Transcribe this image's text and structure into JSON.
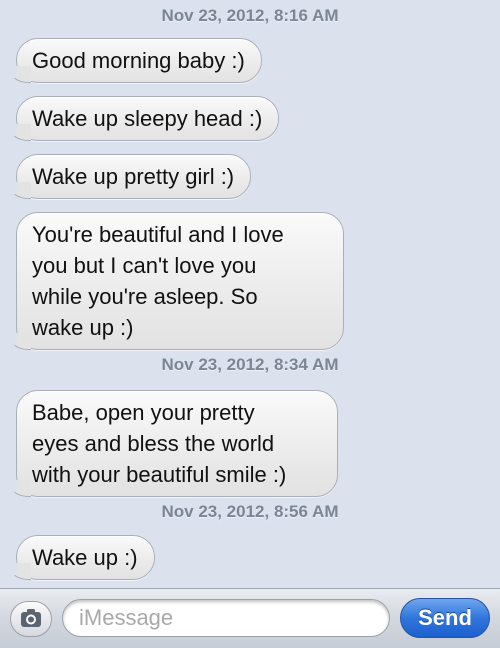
{
  "thread": {
    "timestamps": [
      "Nov 23, 2012, 8:16 AM",
      "Nov 23, 2012, 8:34 AM",
      "Nov 23, 2012, 8:56 AM"
    ],
    "messages": [
      "Good morning baby :)",
      "Wake up sleepy head :)",
      "Wake up pretty girl :)",
      "You're beautiful and I love\nyou but I can't love you\nwhile you're asleep. So\nwake up :)",
      "Babe, open your pretty\neyes and bless the world\nwith your beautiful smile :)",
      "Wake up :)"
    ]
  },
  "composer": {
    "placeholder": "iMessage",
    "send_label": "Send",
    "camera_icon": "camera-icon",
    "send_color": "#2f76dc"
  }
}
